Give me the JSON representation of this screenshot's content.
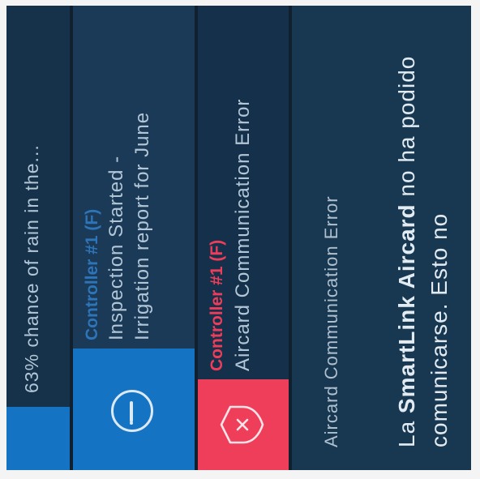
{
  "notifications": [
    {
      "id": "weather",
      "icon": "info-circle-icon",
      "accent": "#1573c3",
      "text": "63% chance of rain in the..."
    },
    {
      "id": "inspection",
      "icon": "info-circle-icon",
      "accent": "#1573c3",
      "title": "Controller #1 (F)",
      "line1": "Inspection Started -",
      "line2": "Irrigation report for June"
    },
    {
      "id": "aircard-error",
      "icon": "shield-x-icon",
      "accent": "#ef3e5a",
      "title": "Controller #1 (F)",
      "line1": "Aircard Communication Error"
    }
  ],
  "detail": {
    "title": "Aircard Communication Error",
    "body_pre": "La ",
    "body_brand": "SmartLink Aircard",
    "body_post": " no ha podido comunicarse. Esto no"
  },
  "colors": {
    "screen_bg": "#10202f",
    "info_accent": "#1573c3",
    "error_accent": "#ef3e5a",
    "text_muted": "#b3c6d6"
  }
}
